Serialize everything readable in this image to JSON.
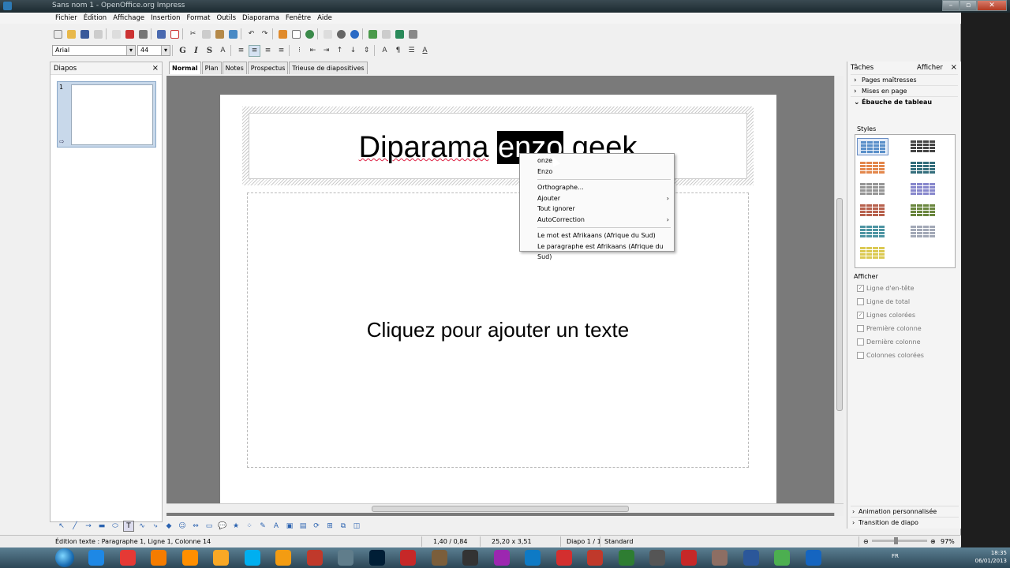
{
  "window": {
    "title": "Sans nom 1 - OpenOffice.org Impress"
  },
  "menu": [
    "Fichier",
    "Édition",
    "Affichage",
    "Insertion",
    "Format",
    "Outils",
    "Diaporama",
    "Fenêtre",
    "Aide"
  ],
  "format_bar": {
    "font": "Arial",
    "size": "44",
    "bold": "G",
    "italic": "I",
    "shadow": "S"
  },
  "slides_pane": {
    "title": "Diapos",
    "thumb_number": "1"
  },
  "view_tabs": [
    "Normal",
    "Plan",
    "Notes",
    "Prospectus",
    "Trieuse de diapositives"
  ],
  "slide": {
    "title_before": "Diparama",
    "title_selected": "enzo",
    "title_after": "geek",
    "placeholder": "Cliquez pour ajouter un texte"
  },
  "context_menu": {
    "suggestions": [
      "onze",
      "Enzo"
    ],
    "items": [
      {
        "label": "Orthographe...",
        "submenu": false
      },
      {
        "label": "Ajouter",
        "submenu": true
      },
      {
        "label": "Tout ignorer",
        "submenu": false
      },
      {
        "label": "AutoCorrection",
        "submenu": true
      }
    ],
    "language_items": [
      "Le mot est Afrikaans (Afrique du Sud)",
      "Le paragraphe est Afrikaans (Afrique du Sud)"
    ]
  },
  "tasks_pane": {
    "title": "Tâches",
    "show_label": "Afficher",
    "sections": [
      "Pages maîtresses",
      "Mises en page",
      "Ébauche de tableau"
    ],
    "styles_label": "Styles",
    "show_section_label": "Afficher",
    "options": [
      {
        "label": "Ligne d'en-tête",
        "checked": true
      },
      {
        "label": "Ligne de total",
        "checked": false
      },
      {
        "label": "Lignes colorées",
        "checked": true
      },
      {
        "label": "Première colonne",
        "checked": false
      },
      {
        "label": "Dernière colonne",
        "checked": false
      },
      {
        "label": "Colonnes colorées",
        "checked": false
      }
    ],
    "bottom_sections": [
      "Animation personnalisée",
      "Transition de diapo"
    ],
    "table_style_colors": [
      "#4a86c5",
      "#333333",
      "#e07b39",
      "#1f5f6e",
      "#8a8a8a",
      "#7b7bc7",
      "#b0503a",
      "#5a7a2a",
      "#3b8a9a",
      "#9aa0b0",
      "#d8c440"
    ]
  },
  "status": {
    "edit_info": "Édition texte : Paragraphe 1, Ligne 1, Colonne 14",
    "position": "1,40 / 0,84",
    "size": "25,20 x 3,51",
    "slide": "Diapo 1 / 1",
    "layout": "Standard",
    "zoom": "97%"
  },
  "taskbar": {
    "lang": "FR",
    "time": "18:35",
    "date": "06/01/2013",
    "apps": [
      "ie",
      "chrome",
      "firefox",
      "vlc",
      "explorer",
      "skype",
      "winamp",
      "popcorn",
      "monitor",
      "photoshop",
      "filezilla",
      "gimp",
      "obs",
      "picasa",
      "teamviewer",
      "acrobat",
      "opera",
      "utorrent",
      "starcraft",
      "k",
      "warcraft",
      "word",
      "gadget",
      "steam"
    ]
  }
}
